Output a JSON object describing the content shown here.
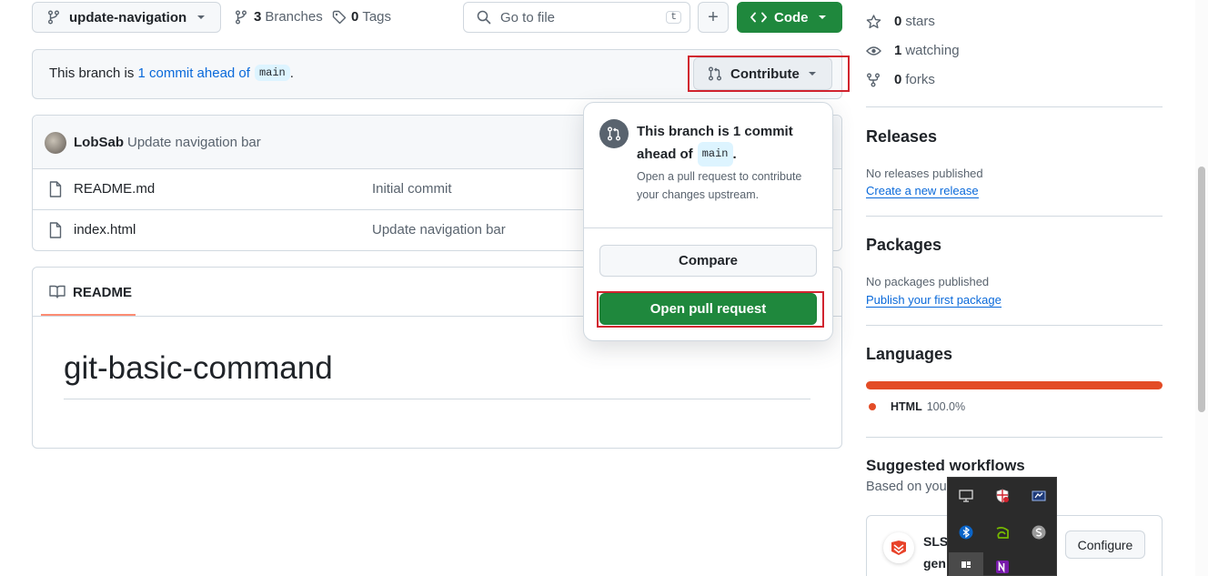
{
  "toolbar": {
    "branch_name": "update-navigation",
    "branches_count": "3",
    "branches_label": "Branches",
    "tags_count": "0",
    "tags_label": "Tags",
    "search_placeholder": "Go to file",
    "search_shortcut": "t",
    "add_label": "+",
    "code_label": "Code"
  },
  "branch_banner": {
    "prefix": "This branch is ",
    "link_text": "1 commit ahead of",
    "base_branch": "main",
    "suffix": ".",
    "contribute_label": "Contribute"
  },
  "commit": {
    "author": "LobSab",
    "message": "Update navigation bar"
  },
  "files": [
    {
      "name": "README.md",
      "commit_message": "Initial commit"
    },
    {
      "name": "index.html",
      "commit_message": "Update navigation bar"
    }
  ],
  "readme": {
    "tab_label": "README",
    "heading": "git-basic-command"
  },
  "contribute_popover": {
    "title_part1": "This branch is 1 commit",
    "title_part2": "ahead of",
    "base_branch": "main",
    "title_suffix": ".",
    "description": "Open a pull request to contribute your changes upstream.",
    "compare_label": "Compare",
    "open_pr_label": "Open pull request"
  },
  "sidebar": {
    "stars": {
      "count": "0",
      "label": "stars"
    },
    "watching": {
      "count": "1",
      "label": "watching"
    },
    "forks": {
      "count": "0",
      "label": "forks"
    },
    "releases": {
      "heading": "Releases",
      "empty_text": "No releases published",
      "link": "Create a new release"
    },
    "packages": {
      "heading": "Packages",
      "empty_text": "No packages published",
      "link": "Publish your first package"
    },
    "languages": {
      "heading": "Languages",
      "items": [
        {
          "name": "HTML",
          "percent": "100.0%",
          "color": "#e34c26",
          "share": 100
        }
      ]
    },
    "workflows": {
      "heading": "Suggested workflows",
      "subtext": "Based on you",
      "item_title_1": "SLS/",
      "item_title_2": "gen",
      "configure_label": "Configure"
    }
  },
  "tray_icons": [
    "monitor-icon",
    "shield-icon",
    "screen-capture-icon",
    "bluetooth-icon",
    "nvidia-icon",
    "skype-icon",
    "taskbar-app-icon",
    "onenote-icon"
  ],
  "colors": {
    "primary_green": "#1f883d",
    "link_blue": "#0969da",
    "highlight_red": "#d1242f",
    "html_language": "#e34c26",
    "readme_tab_underline": "#fd8c73"
  }
}
